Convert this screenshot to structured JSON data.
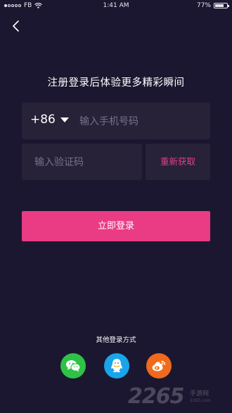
{
  "status_bar": {
    "carrier": "FB",
    "time": "1:41 AM",
    "battery_percent": "77%",
    "battery_level": 0.77,
    "signal_bars_filled": 1,
    "signal_bars_total": 5
  },
  "header": {
    "back_icon": "chevron-left-icon"
  },
  "title": "注册登录后体验更多精彩瞬间",
  "phone": {
    "country_code": "+86",
    "placeholder": "输入手机号码",
    "value": ""
  },
  "verification": {
    "placeholder": "输入验证码",
    "value": "",
    "resend_label": "重新获取"
  },
  "login_button_label": "立即登录",
  "other_login": {
    "label": "其他登录方式",
    "providers": [
      {
        "icon": "wechat-icon",
        "color": "#2ec247"
      },
      {
        "icon": "qq-icon",
        "color": "#1aa4ea"
      },
      {
        "icon": "weibo-icon",
        "color": "#f06a1b"
      }
    ]
  },
  "watermark": {
    "brand": "2265",
    "sub": "手游网",
    "url": "2265.com"
  },
  "colors": {
    "background": "#1c1730",
    "field": "#272238",
    "accent": "#ea3b85"
  }
}
